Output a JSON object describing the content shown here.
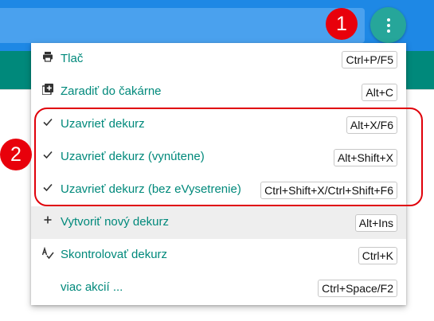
{
  "badges": {
    "first": "1",
    "second": "2"
  },
  "menu": {
    "items": [
      {
        "icon": "printer-icon",
        "label": "Tlač",
        "shortcut": "Ctrl+P/F5"
      },
      {
        "icon": "add-box-icon",
        "label": "Zaradiť do čakárne",
        "shortcut": "Alt+C"
      },
      {
        "icon": "check-icon",
        "label": "Uzavrieť dekurz",
        "shortcut": "Alt+X/F6"
      },
      {
        "icon": "check-icon",
        "label": "Uzavrieť dekurz (vynútene)",
        "shortcut": "Alt+Shift+X"
      },
      {
        "icon": "check-icon",
        "label": "Uzavrieť dekurz (bez eVysetrenie)",
        "shortcut": "Ctrl+Shift+X/Ctrl+Shift+F6"
      },
      {
        "icon": "plus-icon",
        "label": "Vytvoriť nový dekurz",
        "shortcut": "Alt+Ins"
      },
      {
        "icon": "spellcheck-icon",
        "label": "Skontrolovať dekurz",
        "shortcut": "Ctrl+K"
      },
      {
        "icon": "",
        "label": "viac akcií ...",
        "shortcut": "Ctrl+Space/F2"
      }
    ]
  },
  "colors": {
    "accent": "#00897b",
    "primary": "#1e88e5",
    "annotation": "#e8000b"
  }
}
